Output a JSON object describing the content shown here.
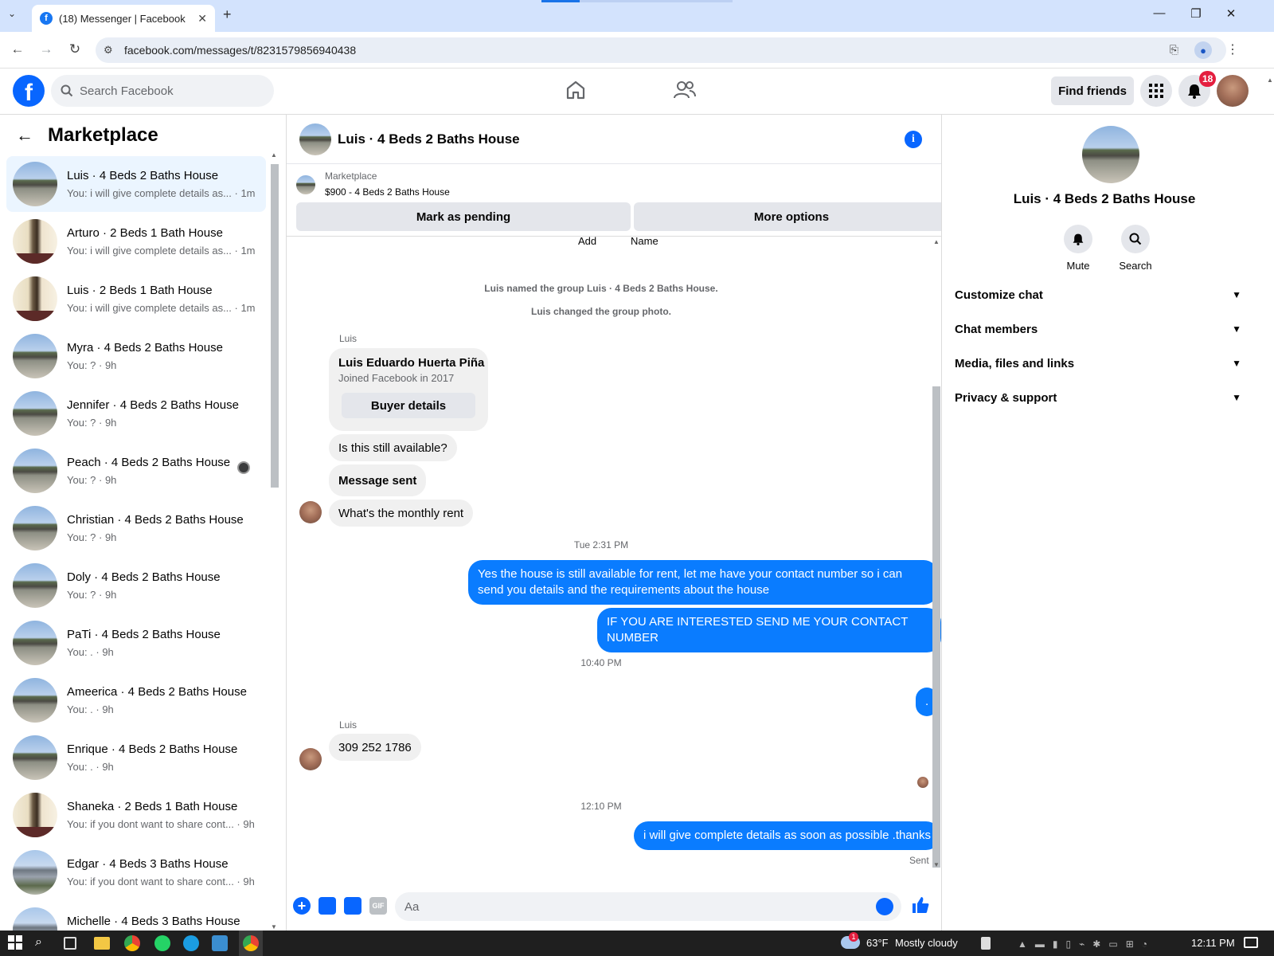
{
  "browser": {
    "tab_title": "(18) Messenger | Facebook",
    "tab_favicon": "f",
    "url": "facebook.com/messages/t/8231579856940438",
    "window_minimize": "—",
    "window_restore": "❐",
    "window_close": "✕",
    "new_tab": "+"
  },
  "fb_header": {
    "logo": "f",
    "search_placeholder": "Search Facebook",
    "find_friends_label": "Find friends",
    "notification_count": "18"
  },
  "left_panel": {
    "title": "Marketplace",
    "conversations": [
      {
        "name": "Luis · 4 Beds 2 Baths House",
        "preview": "You: i will give complete details as... · 1m",
        "avatar": "house",
        "selected": true
      },
      {
        "name": "Arturo · 2 Beds 1 Bath House",
        "preview": "You: i will give complete details as... · 1m",
        "avatar": "room"
      },
      {
        "name": "Luis · 2 Beds 1 Bath House",
        "preview": "You: i will give complete details as... · 1m",
        "avatar": "room"
      },
      {
        "name": "Myra · 4 Beds 2 Baths House",
        "preview": "You: ? · 9h",
        "avatar": "house"
      },
      {
        "name": "Jennifer · 4 Beds 2 Baths House",
        "preview": "You: ? · 9h",
        "avatar": "house"
      },
      {
        "name": "Peach · 4 Beds 2 Baths House",
        "preview": "You: ? · 9h",
        "avatar": "house"
      },
      {
        "name": "Christian · 4 Beds 2 Baths House",
        "preview": "You: ? · 9h",
        "avatar": "house"
      },
      {
        "name": "Doly · 4 Beds 2 Baths House",
        "preview": "You: ? · 9h",
        "avatar": "house"
      },
      {
        "name": "PaTi · 4 Beds 2 Baths House",
        "preview": "You: . · 9h",
        "avatar": "house"
      },
      {
        "name": "Ameerica · 4 Beds 2 Baths House",
        "preview": "You: . · 9h",
        "avatar": "house"
      },
      {
        "name": "Enrique · 4 Beds 2 Baths House",
        "preview": "You: . · 9h",
        "avatar": "house"
      },
      {
        "name": "Shaneka · 2 Beds 1 Bath House",
        "preview": "You: if you dont want to share cont... · 9h",
        "avatar": "room"
      },
      {
        "name": "Edgar · 4 Beds 3 Baths House",
        "preview": "You: if you dont want to share cont... · 9h",
        "avatar": "gray"
      },
      {
        "name": "Michelle · 4 Beds 3 Baths House",
        "preview": "You: if you dont want to share cont... · 9h",
        "avatar": "gray"
      }
    ]
  },
  "chat": {
    "title": "Luis · 4 Beds 2 Baths House",
    "marketplace_label": "Marketplace",
    "listing": "$900 - 4 Beds 2 Baths House",
    "mark_pending_label": "Mark as pending",
    "more_options_label": "More options",
    "cut_add": "Add",
    "cut_name": "Name",
    "system_1": "Luis named the group Luis · 4 Beds 2 Baths House.",
    "system_2": "Luis changed the group photo.",
    "sender_1": "Luis",
    "profile_name": "Luis Eduardo Huerta Piña",
    "profile_joined": "Joined Facebook in 2017",
    "buyer_details_label": "Buyer details",
    "msg_still_available": "Is this still available?",
    "msg_message_sent": "Message sent",
    "msg_monthly_rent": "What's the monthly rent",
    "time_1": "Tue 2:31 PM",
    "out_1": "Yes the house is still available for rent, let me have your contact number so i can send you details and the requirements about the house",
    "out_2": "IF YOU ARE INTERESTED SEND ME YOUR CONTACT NUMBER",
    "time_2": "10:40 PM",
    "out_3": ".",
    "sender_2": "Luis",
    "msg_phone": "309 252 1786",
    "time_3": "12:10 PM",
    "out_4": "i will give complete details as soon as possible .thanks",
    "sent_label": "Sent",
    "composer_placeholder": "Aa",
    "gif_label": "GIF"
  },
  "right_panel": {
    "name": "Luis · 4 Beds 2 Baths House",
    "mute_label": "Mute",
    "search_label": "Search",
    "sections": [
      "Customize chat",
      "Chat members",
      "Media, files and links",
      "Privacy & support"
    ]
  },
  "taskbar": {
    "weather_temp": "63°F",
    "weather_desc": "Mostly cloudy",
    "time": "12:11 PM",
    "weather_alert": "1"
  },
  "colors": {
    "fb_blue": "#0866ff",
    "outgoing_bubble": "#0a7cff",
    "selected_row": "#ebf5ff",
    "badge_red": "#e41e3f"
  }
}
